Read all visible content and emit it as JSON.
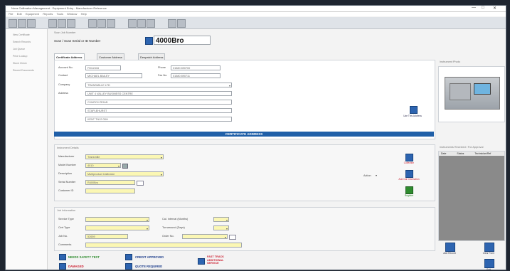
{
  "window": {
    "title": "Nova Calibration Management - Equipment Entry - Manufacturer Reference",
    "controls": [
      "—",
      "□",
      "✕"
    ]
  },
  "menu": [
    "File",
    "Edit",
    "Equipment",
    "Reports",
    "Tools",
    "Window",
    "Help"
  ],
  "sidebar": {
    "items": [
      "New Certificate",
      "Search Records",
      "Job Queue",
      "Price Lookup",
      "Stock Check",
      "Recent Documents"
    ]
  },
  "search": {
    "label": "Scan / Scan Serial or ID Number",
    "value": "4000Bro",
    "section": "Scan Job Number"
  },
  "tabs": [
    "Certificate Address",
    "Customer Address",
    "Despatch Address"
  ],
  "address": {
    "account_label": "Account No.",
    "account_value": "FM12434",
    "contact_label": "Contact",
    "contact_value": "MICHAEL BAILEY",
    "company_label": "Company",
    "company_value": "TRANSMILLE LTD",
    "address_label": "Address",
    "lines": [
      "UNIT 4 VALLEY BUSINESS CENTRE",
      "CHURCH ROAD",
      "STAPLEHURST",
      "KENT TN12 0DH"
    ],
    "phone_label": "Phone",
    "phone_value": "01580 890700",
    "fax_label": "Fax No.",
    "fax_value": "01580 890711",
    "button": "Use This Address",
    "banner": "CERTIFICATE ADDRESS"
  },
  "photo": {
    "label": "Instrument Photo"
  },
  "instrument": {
    "section": "Instrument Details",
    "manufacturer_label": "Manufacturer",
    "manufacturer_value": "Transmille",
    "model_label": "Model Number",
    "model_value": "4010",
    "description_label": "Description",
    "description_value": "Multiproduct Calibrator",
    "serial_label": "Serial Number",
    "serial_value": "R400Bro",
    "customer_id_label": "Customer ID",
    "customer_id_value": "",
    "action_label": "Action",
    "btn_labels": [
      "Collection",
      "Add Cal Information",
      "Register"
    ]
  },
  "history": {
    "label": "Instruments Received / For Approval",
    "columns": [
      "Date",
      "Status",
      "Technician/Ref"
    ]
  },
  "job": {
    "section": "Job Information",
    "service_label": "Service Type",
    "service_value": "",
    "cal_interval_label": "Cal. Interval (Months)",
    "cal_interval_value": "",
    "cert_type_label": "Cert Type",
    "cert_type_value": "",
    "turnaround_label": "Turnaround (Days)",
    "turnaround_value": "",
    "job_label": "Job No.",
    "job_value": "52659",
    "order_label": "Order No.",
    "order_value": "",
    "comments_label": "Comments",
    "comments_value": ""
  },
  "flags": {
    "electrical_safety": "NEEDS SAFETY TEST",
    "damaged": "DAMAGED",
    "credit_approved": "CREDIT APPROVED",
    "quote_required": "QUOTE REQUIRED",
    "fast_track": "FAST TRACK ADDITIONAL SERVICE"
  },
  "bottom_buttons": [
    "Add Record",
    "Clear Form",
    "Exit"
  ],
  "colors": {
    "banner": "#1f5fa8",
    "accent": "#2d64b0",
    "warning": "#cc2233",
    "safety": "#2f8c2f"
  }
}
